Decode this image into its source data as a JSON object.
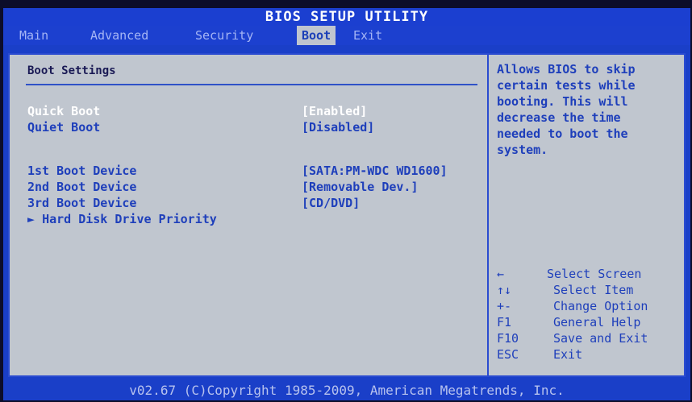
{
  "title": "BIOS SETUP UTILITY",
  "tabs": [
    {
      "label": "Main"
    },
    {
      "label": "Advanced"
    },
    {
      "label": "Security"
    },
    {
      "label": "Boot"
    },
    {
      "label": "Exit"
    }
  ],
  "boot_settings": {
    "heading": "Boot Settings",
    "options": [
      {
        "label": "Quick Boot",
        "value": "[Enabled]"
      },
      {
        "label": "Quiet Boot",
        "value": "[Disabled]"
      },
      {
        "label": "1st Boot Device",
        "value": "[SATA:PM-WDC WD1600]"
      },
      {
        "label": "2nd Boot Device",
        "value": "[Removable Dev.]"
      },
      {
        "label": "3rd Boot Device",
        "value": "[CD/DVD]"
      }
    ],
    "submenu": {
      "arrow": "►",
      "label": "Hard Disk Drive Priority"
    }
  },
  "help_text": "Allows BIOS to skip\ncertain tests while\nbooting. This will\ndecrease the time\nneeded to boot the\nsystem.",
  "key_legend": [
    {
      "key": "←",
      "desc": "Select Screen"
    },
    {
      "key": "↑↓",
      "desc": "Select Item"
    },
    {
      "key": "+-",
      "desc": "Change Option"
    },
    {
      "key": "F1",
      "desc": "General Help"
    },
    {
      "key": "F10",
      "desc": "Save and Exit"
    },
    {
      "key": "ESC",
      "desc": "Exit"
    }
  ],
  "footer": "v02.67 (C)Copyright 1985-2009, American Megatrends, Inc."
}
